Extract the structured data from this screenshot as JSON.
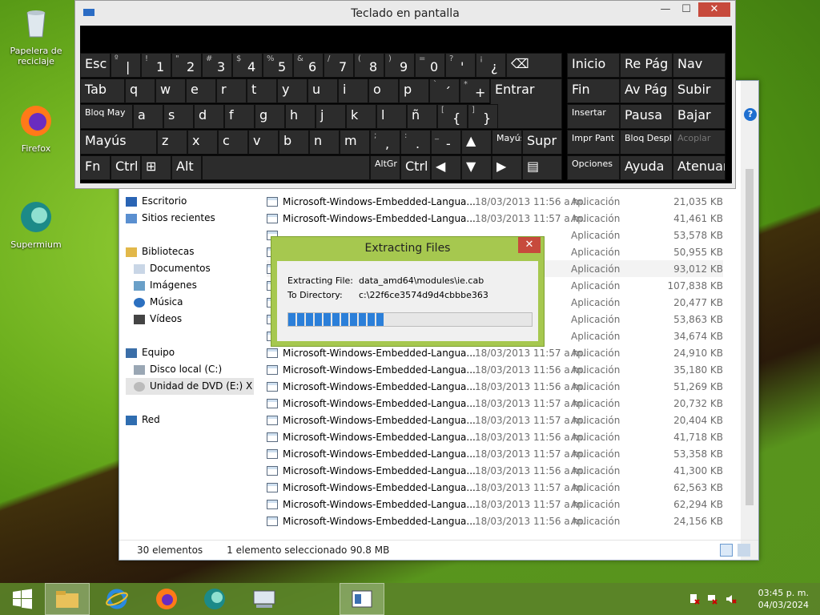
{
  "desktop": {
    "icons": [
      {
        "label": "Papelera de reciclaje",
        "icon": "recycle-bin-icon"
      },
      {
        "label": "Firefox",
        "icon": "firefox-icon"
      },
      {
        "label": "Supermium",
        "icon": "supermium-icon"
      }
    ]
  },
  "osk": {
    "title": "Teclado en pantalla",
    "min": "—",
    "max": "☐",
    "close": "✕",
    "keys": {
      "esc": "Esc",
      "tab": "Tab",
      "caps": "Bloq May",
      "shift": "Mayús",
      "fn": "Fn",
      "ctrl": "Ctrl",
      "alt": "Alt",
      "altgr": "AltGr",
      "ctrl2": "Ctrl",
      "enter": "Entrar",
      "supr": "Supr",
      "shift2": "Mayús",
      "inicio": "Inicio",
      "repag": "Re Pág",
      "nav": "Nav",
      "fin": "Fin",
      "avpag": "Av Pág",
      "subir": "Subir",
      "insertar": "Insertar",
      "pausa": "Pausa",
      "bajar": "Bajar",
      "imprpant": "Impr Pant",
      "bloqdespl": "Bloq Despl",
      "acoplar": "Acoplar",
      "opciones": "Opciones",
      "ayuda": "Ayuda",
      "atenuar": "Atenuar",
      "row1": [
        {
          "s": "º",
          "m": "|"
        },
        {
          "s": "!",
          "m": "1"
        },
        {
          "s": "\"",
          "m": "2"
        },
        {
          "s": "#",
          "m": "3"
        },
        {
          "s": "$",
          "m": "4"
        },
        {
          "s": "%",
          "m": "5"
        },
        {
          "s": "&",
          "m": "6"
        },
        {
          "s": "/",
          "m": "7"
        },
        {
          "s": "(",
          "m": "8"
        },
        {
          "s": ")",
          "m": "9"
        },
        {
          "s": "=",
          "m": "0"
        },
        {
          "s": "?",
          "m": "'"
        },
        {
          "s": "¡",
          "m": "¿"
        }
      ],
      "row2": [
        "q",
        "w",
        "e",
        "r",
        "t",
        "y",
        "u",
        "i",
        "o",
        "p"
      ],
      "row2_extra": [
        {
          "s": "`",
          "m": "´"
        },
        {
          "s": "*",
          "m": "+"
        }
      ],
      "row3": [
        "a",
        "s",
        "d",
        "f",
        "g",
        "h",
        "j",
        "k",
        "l",
        "ñ"
      ],
      "row3_extra": [
        {
          "s": "[",
          "m": "{"
        },
        {
          "s": "]",
          "m": "}"
        }
      ],
      "row4": [
        "z",
        "x",
        "c",
        "v",
        "b",
        "n",
        "m"
      ],
      "row4_extra": [
        {
          "s": ";",
          "m": ","
        },
        {
          "s": ":",
          "m": "."
        },
        {
          "s": "_",
          "m": "-"
        }
      ],
      "arrow_up": "▲",
      "arrow_left": "◀",
      "arrow_down": "▼",
      "arrow_right": "▶"
    }
  },
  "explorer": {
    "nav": [
      {
        "label": "Escritorio",
        "icon": "desktop-icon"
      },
      {
        "label": "Sitios recientes",
        "icon": "recent-places-icon"
      },
      {
        "label": "",
        "icon": ""
      },
      {
        "label": "Bibliotecas",
        "icon": "libraries-icon"
      },
      {
        "label": "Documentos",
        "icon": "documents-icon"
      },
      {
        "label": "Imágenes",
        "icon": "pictures-icon"
      },
      {
        "label": "Música",
        "icon": "music-icon"
      },
      {
        "label": "Vídeos",
        "icon": "videos-icon"
      },
      {
        "label": "",
        "icon": ""
      },
      {
        "label": "Equipo",
        "icon": "computer-icon"
      },
      {
        "label": "Disco local (C:)",
        "icon": "drive-icon"
      },
      {
        "label": "Unidad de DVD (E:) X",
        "icon": "dvd-drive-icon"
      },
      {
        "label": "",
        "icon": ""
      },
      {
        "label": "Red",
        "icon": "network-icon"
      }
    ],
    "rows": [
      {
        "name": "Microsoft-Windows-Embedded-Langua...",
        "date": "18/03/2013 11:56 a.m.",
        "type": "Aplicación",
        "size": "21,035 KB"
      },
      {
        "name": "Microsoft-Windows-Embedded-Langua...",
        "date": "18/03/2013 11:57 a.m.",
        "type": "Aplicación",
        "size": "41,461 KB"
      },
      {
        "name": "",
        "date": "",
        "type": "Aplicación",
        "size": "53,578 KB"
      },
      {
        "name": "",
        "date": "",
        "type": "Aplicación",
        "size": "50,955 KB"
      },
      {
        "name": "",
        "date": "",
        "type": "Aplicación",
        "size": "93,012 KB"
      },
      {
        "name": "",
        "date": "",
        "type": "Aplicación",
        "size": "107,838 KB"
      },
      {
        "name": "",
        "date": "",
        "type": "Aplicación",
        "size": "20,477 KB"
      },
      {
        "name": "",
        "date": "",
        "type": "Aplicación",
        "size": "53,863 KB"
      },
      {
        "name": "",
        "date": "",
        "type": "Aplicación",
        "size": "34,674 KB"
      },
      {
        "name": "Microsoft-Windows-Embedded-Langua...",
        "date": "18/03/2013 11:57 a.m.",
        "type": "Aplicación",
        "size": "24,910 KB"
      },
      {
        "name": "Microsoft-Windows-Embedded-Langua...",
        "date": "18/03/2013 11:56 a.m.",
        "type": "Aplicación",
        "size": "35,180 KB"
      },
      {
        "name": "Microsoft-Windows-Embedded-Langua...",
        "date": "18/03/2013 11:56 a.m.",
        "type": "Aplicación",
        "size": "51,269 KB"
      },
      {
        "name": "Microsoft-Windows-Embedded-Langua...",
        "date": "18/03/2013 11:57 a.m.",
        "type": "Aplicación",
        "size": "20,732 KB"
      },
      {
        "name": "Microsoft-Windows-Embedded-Langua...",
        "date": "18/03/2013 11:57 a.m.",
        "type": "Aplicación",
        "size": "20,404 KB"
      },
      {
        "name": "Microsoft-Windows-Embedded-Langua...",
        "date": "18/03/2013 11:56 a.m.",
        "type": "Aplicación",
        "size": "41,718 KB"
      },
      {
        "name": "Microsoft-Windows-Embedded-Langua...",
        "date": "18/03/2013 11:57 a.m.",
        "type": "Aplicación",
        "size": "53,358 KB"
      },
      {
        "name": "Microsoft-Windows-Embedded-Langua...",
        "date": "18/03/2013 11:56 a.m.",
        "type": "Aplicación",
        "size": "41,300 KB"
      },
      {
        "name": "Microsoft-Windows-Embedded-Langua...",
        "date": "18/03/2013 11:57 a.m.",
        "type": "Aplicación",
        "size": "62,563 KB"
      },
      {
        "name": "Microsoft-Windows-Embedded-Langua...",
        "date": "18/03/2013 11:57 a.m.",
        "type": "Aplicación",
        "size": "62,294 KB"
      },
      {
        "name": "Microsoft-Windows-Embedded-Langua...",
        "date": "18/03/2013 11:56 a.m.",
        "type": "Aplicación",
        "size": "24,156 KB"
      }
    ],
    "status_count": "30 elementos",
    "status_selected": "1 elemento seleccionado  90.8 MB"
  },
  "dialog": {
    "title": "Extracting Files",
    "close": "✕",
    "file_label": "Extracting File:",
    "file_value": "data_amd64\\modules\\ie.cab",
    "dir_label": "To Directory:",
    "dir_value": "c:\\22f6ce3574d9d4cbbbe363",
    "progress": 0.39
  },
  "taskbar": {
    "apps": [
      "start-icon",
      "file-explorer-icon",
      "internet-explorer-icon",
      "firefox-icon",
      "supermium-icon",
      "on-screen-keyboard-icon",
      "installer-icon"
    ],
    "time": "03:45 p. m.",
    "date": "04/03/2024"
  }
}
